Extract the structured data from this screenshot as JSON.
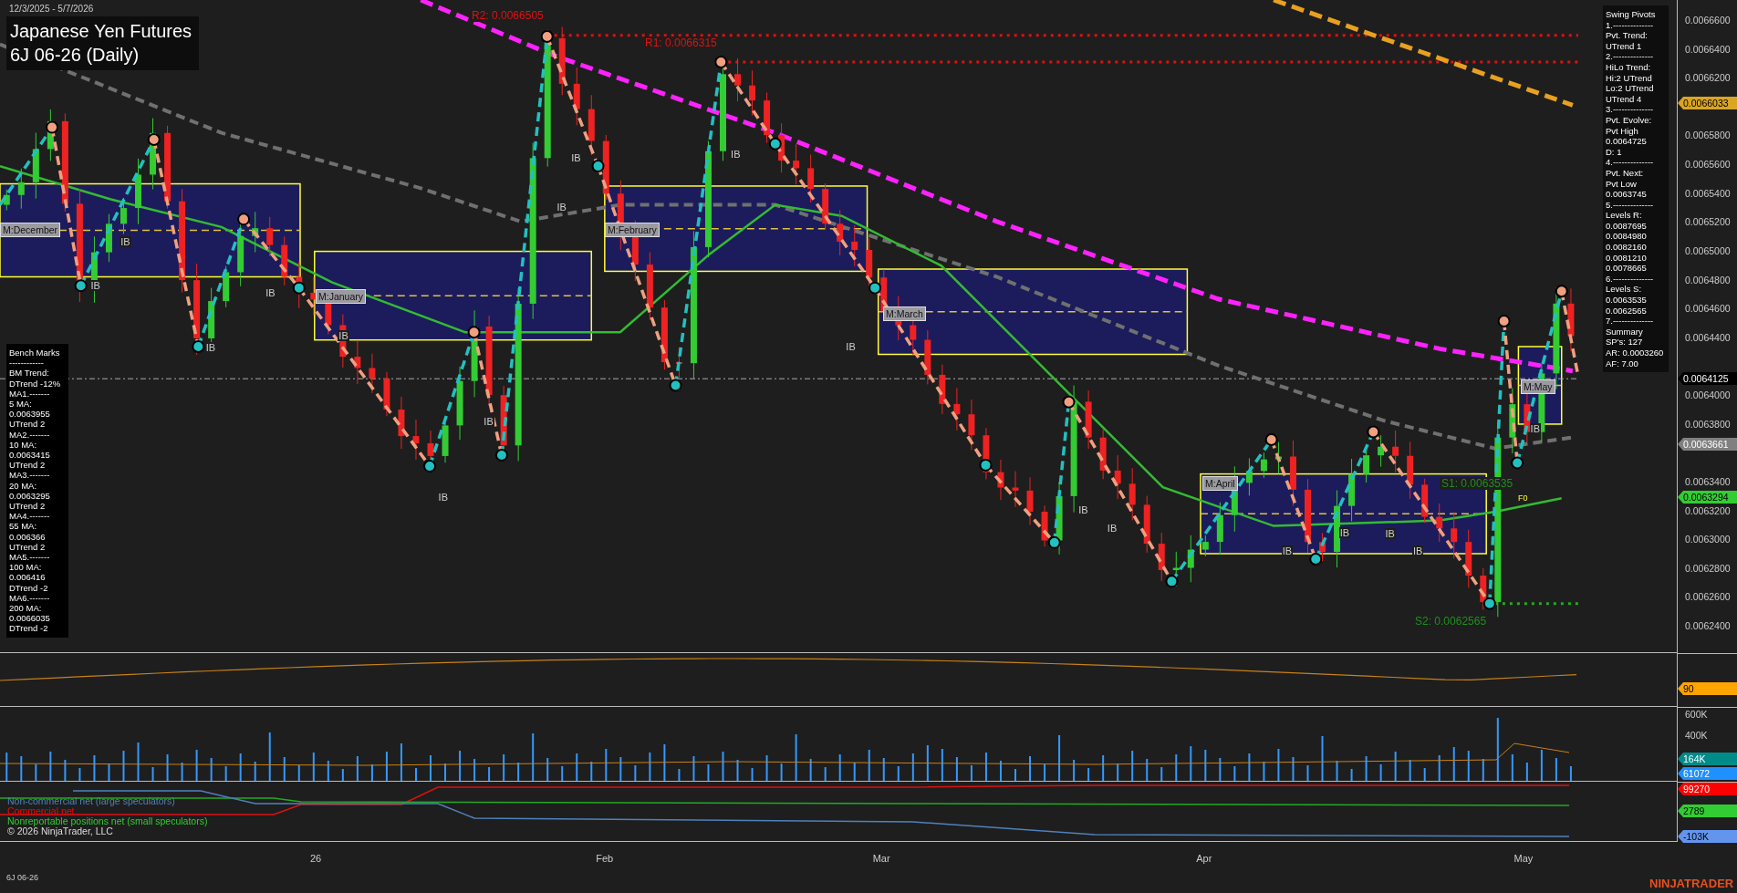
{
  "header": {
    "date_range": "12/3/2025 - 5/7/2026",
    "title": "Japanese Yen Futures",
    "subtitle": "6J 06-26 (Daily)"
  },
  "swing_pivots": [
    "Swing Pivots",
    "1.--------------",
    "Pvt. Trend:",
    "UTrend 1",
    "2.--------------",
    "HiLo Trend:",
    "Hi:2 UTrend",
    "Lo:2 UTrend",
    "UTrend 4",
    "3.--------------",
    "Pvt. Evolve:",
    "Pvt High",
    "0.0064725",
    "D: 1",
    "4.--------------",
    "Pvt. Next:",
    "Pvt Low",
    "0.0063745",
    "5.--------------",
    "Levels R:",
    "0.0087695",
    "0.0084980",
    "0.0082160",
    "0.0081210",
    "0.0078665",
    "6.--------------",
    "Levels S:",
    "0.0063535",
    "0.0062565",
    "7.--------------",
    "Summary",
    "SP's: 127",
    "AR: 0.0003260",
    "AF: 7.00"
  ],
  "bench_marks": [
    "Bench Marks",
    "------------",
    "BM Trend:",
    "DTrend -12%",
    "MA1.-------",
    "5 MA:",
    "0.0063955",
    "UTrend 2",
    "MA2.-------",
    "10 MA:",
    "0.0063415",
    "UTrend 2",
    "MA3.-------",
    "20 MA:",
    "0.0063295",
    "UTrend 2",
    "MA4.-------",
    "55 MA:",
    "0.006366",
    "UTrend 2",
    "MA5.-------",
    "100 MA:",
    "0.006416",
    "DTrend -2",
    "MA6.-------",
    "200 MA:",
    "0.0066035",
    "DTrend -2"
  ],
  "levels": [
    {
      "text": "R2: 0.0066505",
      "kind": "resistance"
    },
    {
      "text": "R1: 0.0066315",
      "kind": "resistance"
    },
    {
      "text": "S1: 0.0063535",
      "kind": "support"
    },
    {
      "text": "S2: 0.0062565",
      "kind": "support"
    }
  ],
  "months": [
    "M:December",
    "M:January",
    "M:February",
    "M:March",
    "M:April",
    "M:May"
  ],
  "ib_labels": [
    "IB",
    "IB",
    "IB",
    "IB",
    "IB",
    "IB",
    "IB",
    "IB",
    "IB",
    "IB",
    "IB",
    "IB",
    "IB",
    "IB",
    "IB",
    "IB",
    "IB",
    "IB"
  ],
  "fib_label": "F0",
  "price_axis": {
    "ticks": [
      "0.0066600",
      "0.0066400",
      "0.0066200",
      "0.0065800",
      "0.0065600",
      "0.0065400",
      "0.0065200",
      "0.0065000",
      "0.0064800",
      "0.0064600",
      "0.0064400",
      "0.0064000",
      "0.0063800",
      "0.0063400",
      "0.0063200",
      "0.0063000",
      "0.0062800",
      "0.0062600",
      "0.0062400"
    ],
    "markers": [
      {
        "text": "0.0066033",
        "color": "#daa520"
      },
      {
        "text": "0.0064125",
        "color": "#000000"
      },
      {
        "text": "0.0063661",
        "color": "#808080"
      },
      {
        "text": "0.0063294",
        "color": "#32cd32"
      }
    ]
  },
  "oscillator_axis": {
    "markers": [
      {
        "text": "90",
        "color": "#ffa500"
      }
    ]
  },
  "volume_axis": {
    "ticks": [
      "600K",
      "400K"
    ],
    "markers": [
      {
        "text": "164K",
        "color": "#008b8b"
      },
      {
        "text": "61072",
        "color": "#1e90ff"
      }
    ]
  },
  "cot": {
    "legend": [
      {
        "text": "Non-commercial net (large speculators)",
        "color": "#4f81bd"
      },
      {
        "text": "Commercial net",
        "color": "#ff0000"
      },
      {
        "text": "Nonreportable positions net (small speculators)",
        "color": "#32cd32"
      }
    ],
    "markers": [
      {
        "text": "99270",
        "color": "#ff0000"
      },
      {
        "text": "2789",
        "color": "#32cd32"
      },
      {
        "text": "-103K",
        "color": "#6495ed"
      }
    ]
  },
  "copyright": "© 2026 NinjaTrader, LLC",
  "time_axis": [
    "26",
    "Feb",
    "Mar",
    "Apr",
    "May"
  ],
  "footer": {
    "instrument": "6J 06-26",
    "brand": "NINJATRADER"
  }
}
